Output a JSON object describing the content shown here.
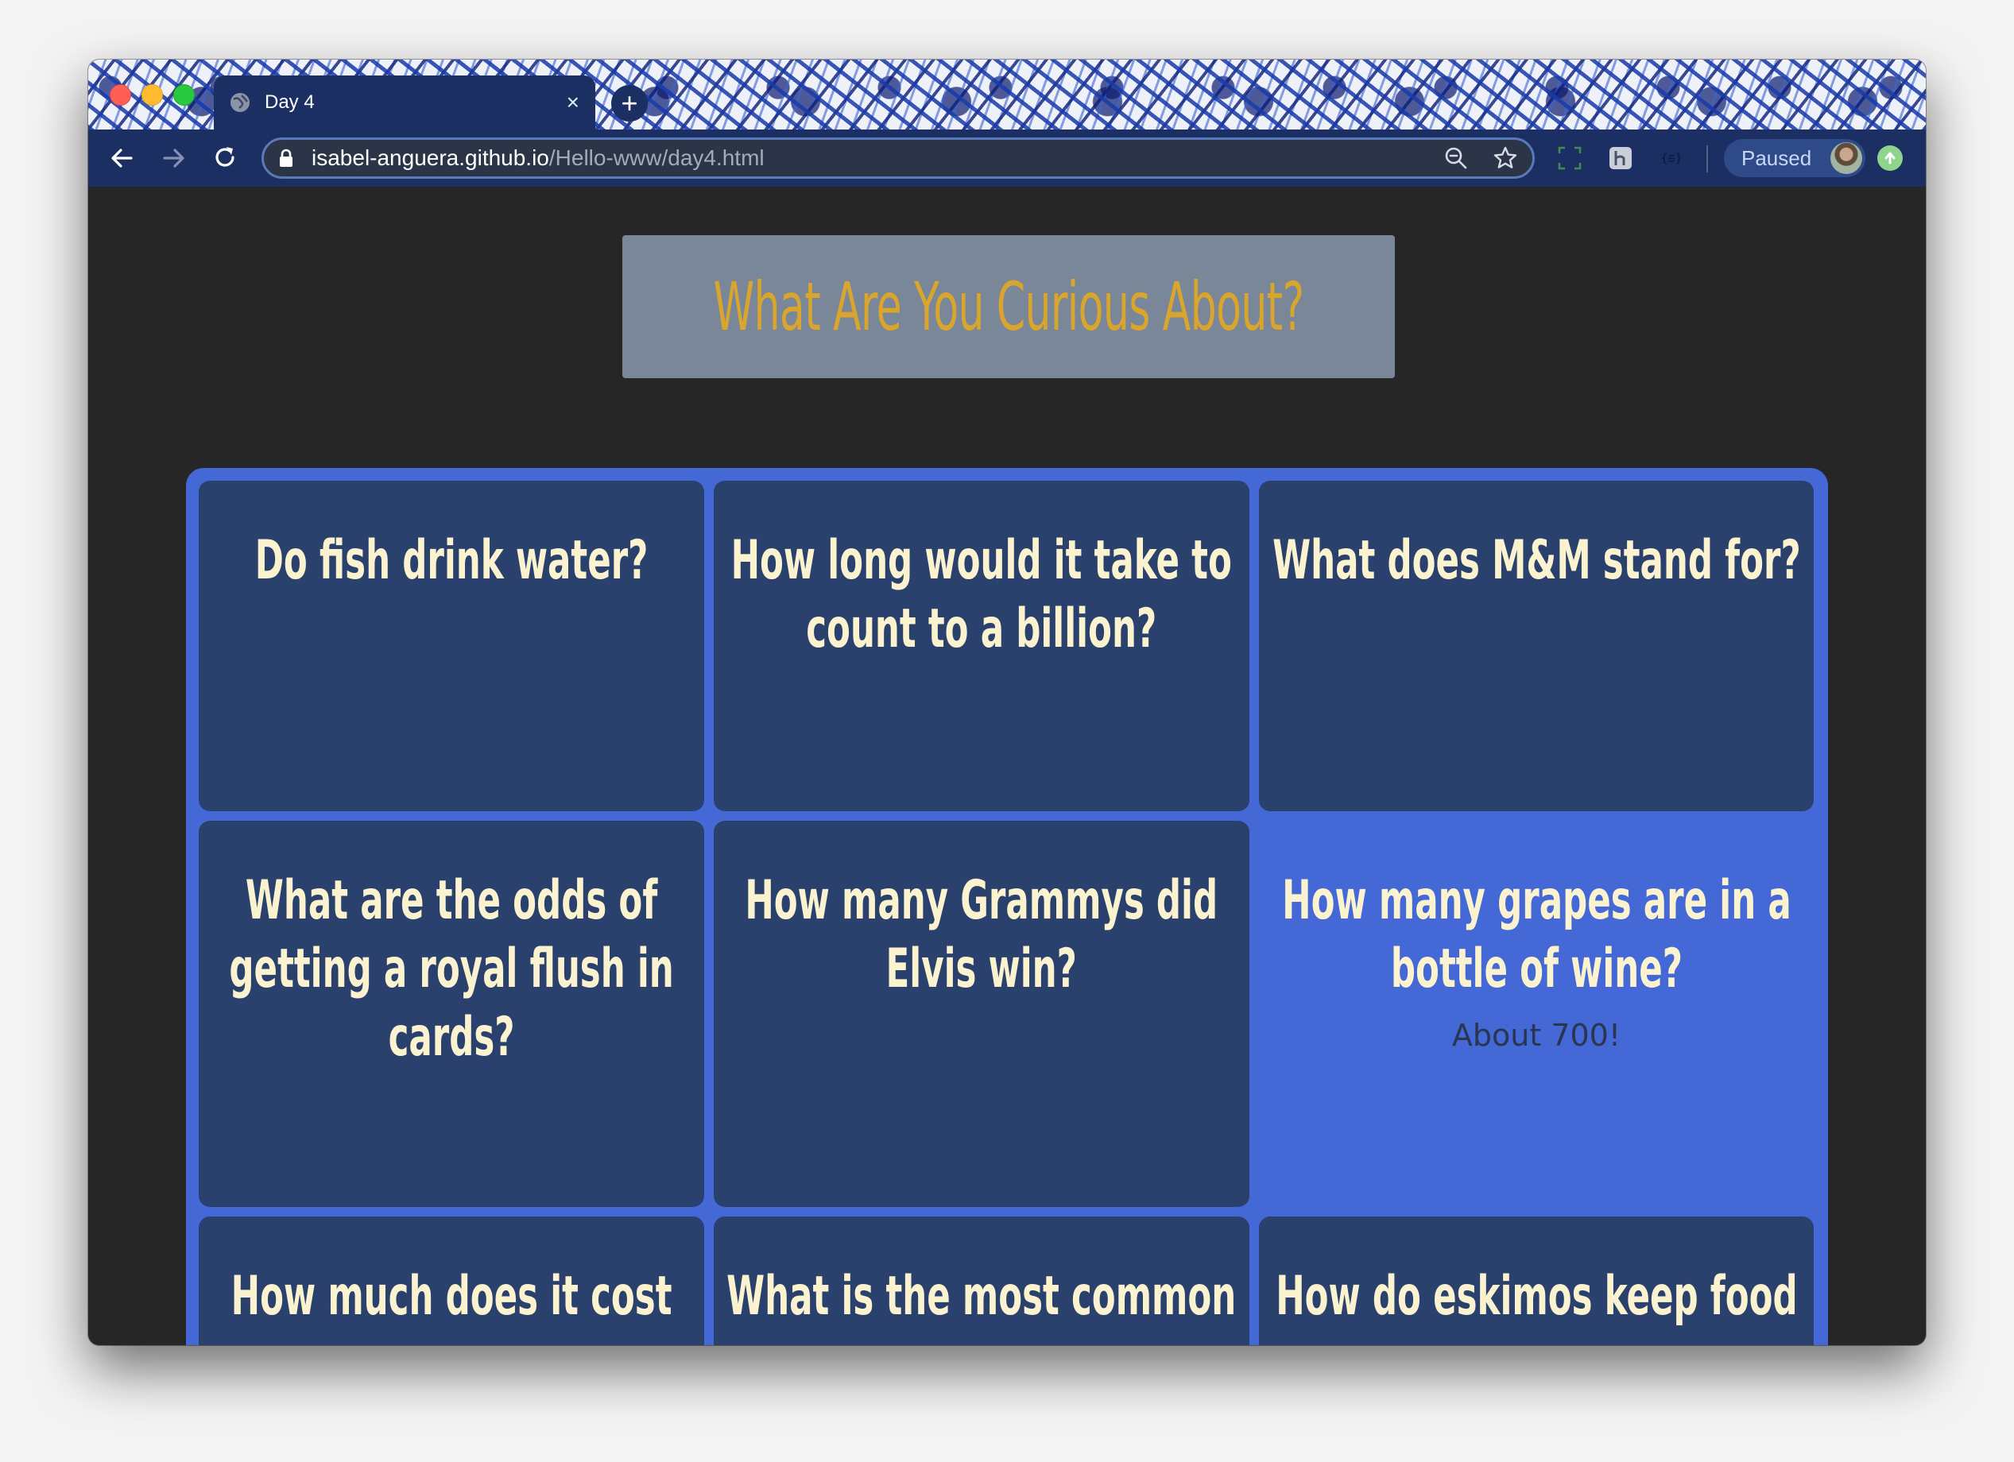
{
  "browser": {
    "tab": {
      "title": "Day 4",
      "close_glyph": "×"
    },
    "new_tab_glyph": "+",
    "address": {
      "host": "isabel-anguera.github.io",
      "path": "/Hello-www/day4.html"
    },
    "profile": {
      "label": "Paused"
    }
  },
  "page": {
    "heading": "What Are You Curious About?",
    "cards": [
      {
        "question": "Do fish drink water?",
        "answer": ""
      },
      {
        "question": "How long would it take to count to a billion?",
        "answer": ""
      },
      {
        "question": "What does M&M stand for?",
        "answer": ""
      },
      {
        "question": "What are the odds of getting a royal flush in cards?",
        "answer": ""
      },
      {
        "question": "How many Grammys did Elvis win?",
        "answer": ""
      },
      {
        "question": "How many grapes are in a bottle of wine?",
        "answer": "About  700!"
      },
      {
        "question": "How much does it cost",
        "answer": ""
      },
      {
        "question": "What is the most common",
        "answer": ""
      },
      {
        "question": "How do eskimos keep food",
        "answer": ""
      }
    ]
  }
}
